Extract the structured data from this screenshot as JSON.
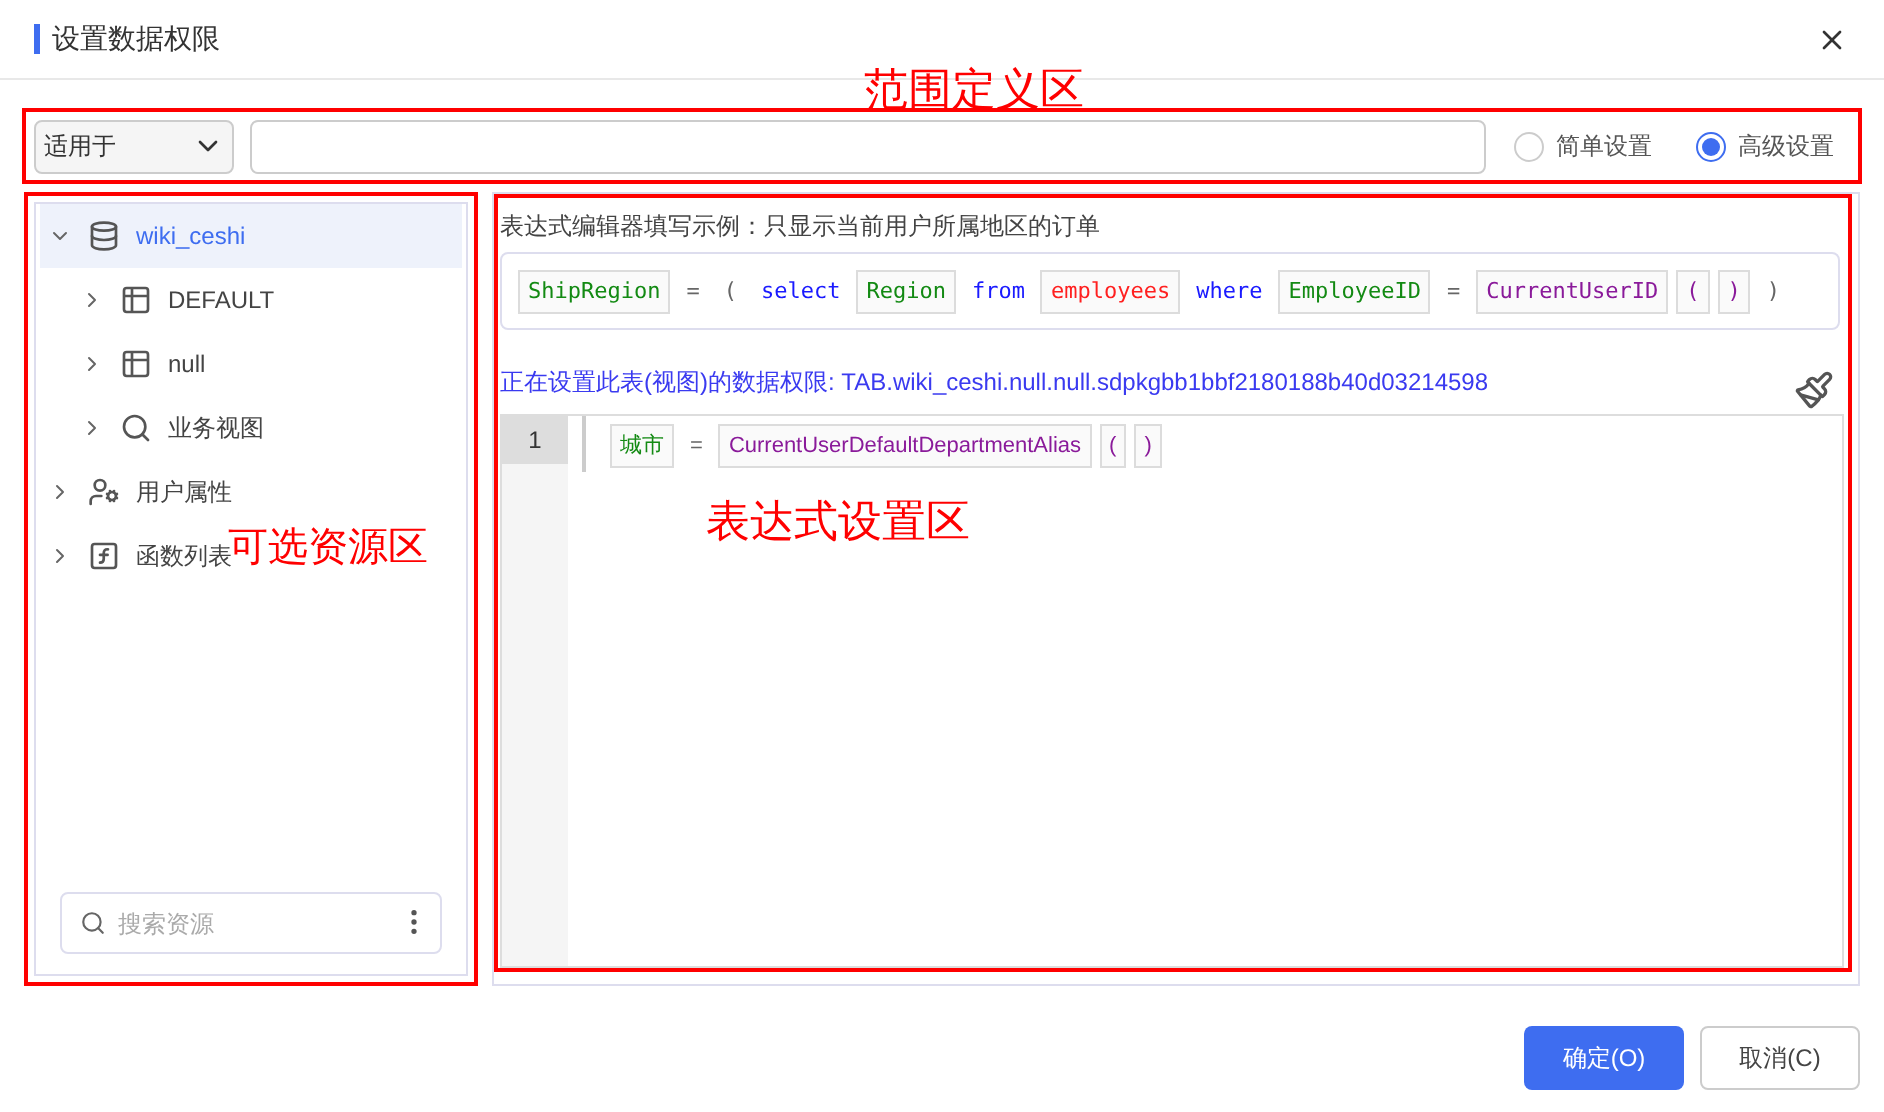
{
  "dialog": {
    "title": "设置数据权限"
  },
  "annotations": [
    {
      "label": "范围定义区"
    },
    {
      "label": "可选资源区"
    },
    {
      "label": "表达式设置区"
    }
  ],
  "scope": {
    "select": "适用于",
    "modes": [
      {
        "label": "简单设置",
        "selected": false
      },
      {
        "label": "高级设置",
        "selected": true
      }
    ]
  },
  "resources": {
    "tree": [
      {
        "label": "wiki_ceshi",
        "kind": "database",
        "expanded": true,
        "selected": true,
        "children": [
          {
            "label": "DEFAULT",
            "kind": "schema",
            "expanded": false,
            "selected": false
          },
          {
            "label": "null",
            "kind": "schema",
            "expanded": false,
            "selected": false
          },
          {
            "label": "业务视图",
            "kind": "view",
            "expanded": false,
            "selected": false
          }
        ]
      },
      {
        "label": "用户属性",
        "kind": "user",
        "expanded": false,
        "selected": false
      },
      {
        "label": "函数列表",
        "kind": "function",
        "expanded": false,
        "selected": false
      }
    ],
    "search": {
      "placeholder": "搜索资源"
    }
  },
  "editor": {
    "example_caption": "表达式编辑器填写示例：只显示当前用户所属地区的订单",
    "example_tokens": [
      {
        "text": "ShipRegion",
        "kind": "field"
      },
      {
        "text": "=",
        "kind": "operator"
      },
      {
        "text": "(",
        "kind": "operator"
      },
      {
        "text": "select",
        "kind": "keyword"
      },
      {
        "text": "Region",
        "kind": "field"
      },
      {
        "text": "from",
        "kind": "keyword"
      },
      {
        "text": "employees",
        "kind": "table"
      },
      {
        "text": "where",
        "kind": "keyword"
      },
      {
        "text": "EmployeeID",
        "kind": "field"
      },
      {
        "text": "=",
        "kind": "operator"
      },
      {
        "text": "CurrentUserID",
        "kind": "function"
      },
      {
        "text": "(",
        "kind": "paren"
      },
      {
        "text": ")",
        "kind": "paren"
      },
      {
        "text": ")",
        "kind": "operator"
      }
    ],
    "target": "正在设置此表(视图)的数据权限: TAB.wiki_ceshi.null.null.sdpkgbb1bbf2180188b40d03214598",
    "lines": [
      {
        "number": "1",
        "tokens": [
          {
            "text": "城市",
            "kind": "field"
          },
          {
            "text": "=",
            "kind": "operator"
          },
          {
            "text": "CurrentUserDefaultDepartmentAlias",
            "kind": "function"
          },
          {
            "text": "(",
            "kind": "paren"
          },
          {
            "text": ")",
            "kind": "paren"
          }
        ]
      }
    ]
  },
  "buttons": [
    {
      "label": "确定(O)",
      "kind": "primary"
    },
    {
      "label": "取消(C)",
      "kind": "secondary"
    }
  ]
}
